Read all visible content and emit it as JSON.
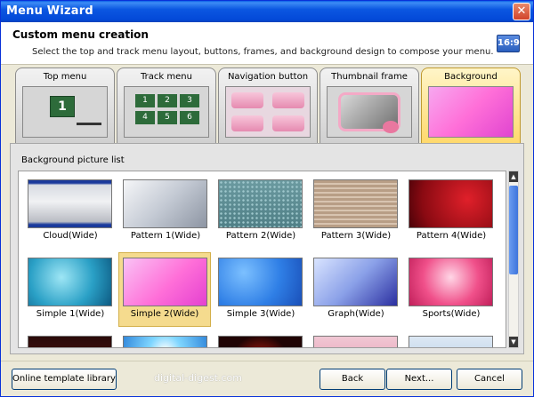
{
  "window": {
    "title": "Menu Wizard",
    "close_glyph": "✕"
  },
  "header": {
    "title": "Custom menu creation",
    "description": "Select the top and track menu layout, buttons, frames, and background design to compose your menu.",
    "ratio_badge": "16:9"
  },
  "tabs": [
    {
      "label": "Top menu",
      "active": false
    },
    {
      "label": "Track menu",
      "active": false
    },
    {
      "label": "Navigation button",
      "active": false
    },
    {
      "label": "Thumbnail frame",
      "active": false
    },
    {
      "label": "Background",
      "active": true
    }
  ],
  "top_menu_preview": {
    "number": "1"
  },
  "track_menu_preview": {
    "numbers": [
      "1",
      "2",
      "3",
      "4",
      "5",
      "6"
    ]
  },
  "panel": {
    "label": "Background picture list"
  },
  "backgrounds": [
    {
      "name": "Cloud(Wide)",
      "selected": false
    },
    {
      "name": "Pattern 1(Wide)",
      "selected": false
    },
    {
      "name": "Pattern 2(Wide)",
      "selected": false
    },
    {
      "name": "Pattern 3(Wide)",
      "selected": false
    },
    {
      "name": "Pattern 4(Wide)",
      "selected": false
    },
    {
      "name": "Simple 1(Wide)",
      "selected": false
    },
    {
      "name": "Simple 2(Wide)",
      "selected": true
    },
    {
      "name": "Simple 3(Wide)",
      "selected": false
    },
    {
      "name": "Graph(Wide)",
      "selected": false
    },
    {
      "name": "Sports(Wide)",
      "selected": false
    }
  ],
  "footer": {
    "online_button": "Online template library",
    "watermark": "digital-digest.com",
    "back_button": "Back",
    "next_button": "Next...",
    "cancel_button": "Cancel"
  }
}
